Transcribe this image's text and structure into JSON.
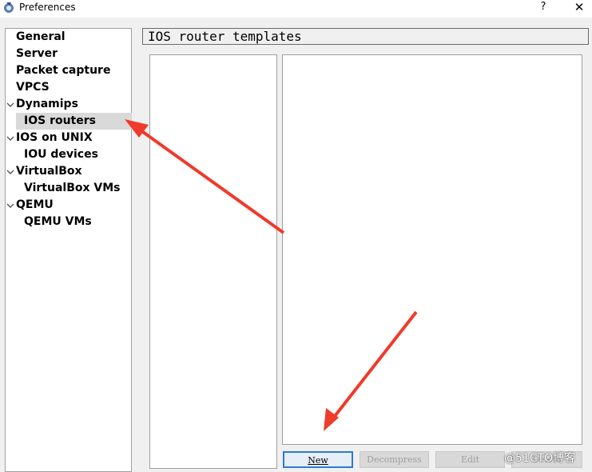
{
  "window": {
    "title": "Preferences",
    "help_label": "?",
    "close_label": "✕"
  },
  "nav": {
    "items": [
      {
        "label": "General",
        "expanded": null
      },
      {
        "label": "Server",
        "expanded": null
      },
      {
        "label": "Packet capture",
        "expanded": null
      },
      {
        "label": "VPCS",
        "expanded": null
      },
      {
        "label": "Dynamips",
        "expanded": true
      },
      {
        "label": "IOS routers",
        "selected": true
      },
      {
        "label": "IOS on UNIX",
        "expanded": true
      },
      {
        "label": "IOU devices"
      },
      {
        "label": "VirtualBox",
        "expanded": true
      },
      {
        "label": "VirtualBox VMs"
      },
      {
        "label": "QEMU",
        "expanded": true
      },
      {
        "label": "QEMU VMs"
      }
    ]
  },
  "main": {
    "title": "IOS router templates",
    "buttons": {
      "new": "New",
      "decompress": "Decompress",
      "edit": "Edit",
      "delete": "Delete"
    }
  },
  "annotations": {
    "arrow_color": "#f03a2a"
  },
  "watermark": "@51CTO博客"
}
